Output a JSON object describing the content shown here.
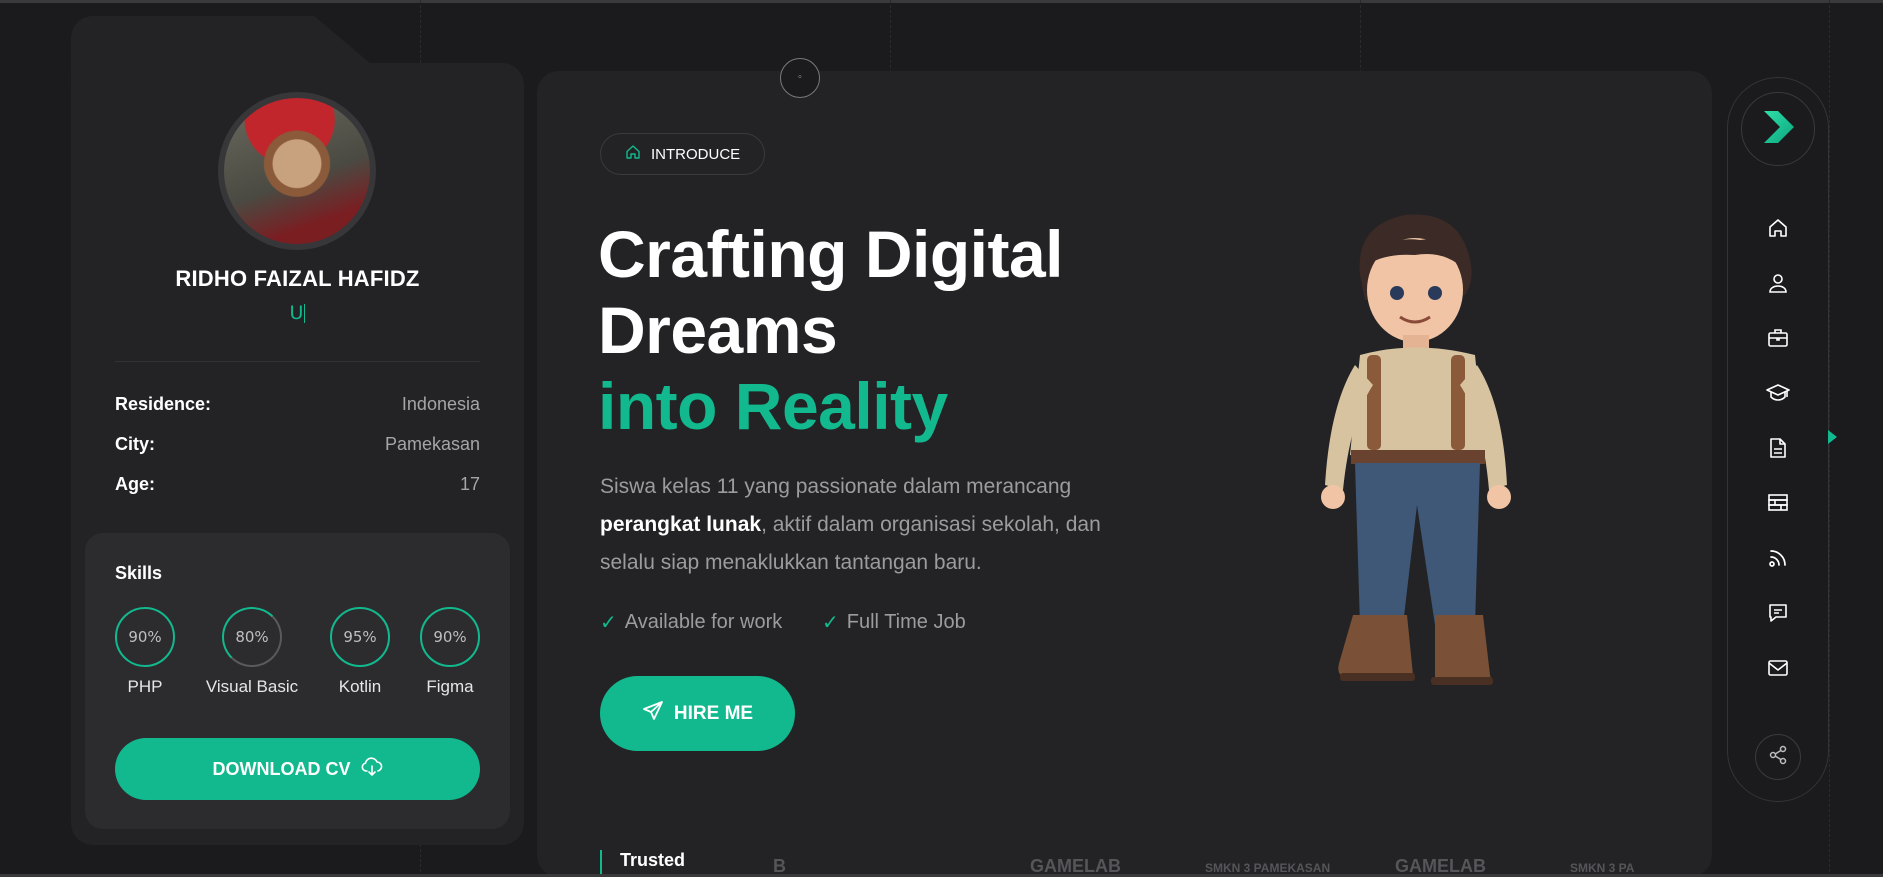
{
  "profile": {
    "name": "RIDHO FAIZAL HAFIDZ",
    "role_typed": "U",
    "info": [
      {
        "key": "Residence:",
        "value": "Indonesia"
      },
      {
        "key": "City:",
        "value": "Pamekasan"
      },
      {
        "key": "Age:",
        "value": "17"
      }
    ],
    "skills_title": "Skills",
    "skills": [
      {
        "percent": "90%",
        "name": "PHP"
      },
      {
        "percent": "80%",
        "name": "Visual Basic"
      },
      {
        "percent": "95%",
        "name": "Kotlin"
      },
      {
        "percent": "90%",
        "name": "Figma"
      }
    ],
    "download_label": "DOWNLOAD CV"
  },
  "hero": {
    "pill_label": "INTRODUCE",
    "headline_line1": "Crafting Digital",
    "headline_line2": "Dreams",
    "headline_accent": "into Reality",
    "desc_part1": "Siswa kelas 11 yang passionate dalam merancang",
    "desc_bold": "perangkat lunak",
    "desc_part2": ", aktif dalam organisasi sekolah, dan selalu siap menaklukkan tantangan baru.",
    "checks": [
      "Available for work",
      "Full Time Job"
    ],
    "hire_label": "HIRE ME",
    "trusted_label": "Trusted",
    "logos": [
      "B",
      "GAMELAB",
      "SMKN 3 PAMEKASAN",
      "GAMELAB",
      "SMKN 3 PA"
    ]
  },
  "nav": {
    "icons": [
      "home-icon",
      "user-icon",
      "briefcase-icon",
      "graduation-cap-icon",
      "document-icon",
      "services-icon",
      "blog-icon",
      "comment-icon",
      "mail-icon"
    ]
  },
  "colors": {
    "accent": "#12b98e",
    "background": "#1b1b1d",
    "card": "#232325"
  }
}
